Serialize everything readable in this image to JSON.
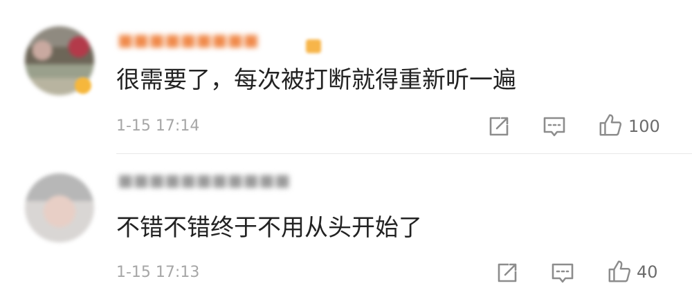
{
  "comments": [
    {
      "username": "■■■■■■■■■",
      "text": "很需要了，每次被打断就得重新听一遍",
      "time": "1-15 17:14",
      "likes": "100"
    },
    {
      "username": "■■■■■■■■■■■",
      "text": "不错不错终于不用从头开始了",
      "time": "1-15 17:13",
      "likes": "40"
    }
  ],
  "icons": {
    "share": "share-icon",
    "reply": "comment-icon",
    "like": "thumbs-up-icon"
  },
  "colors": {
    "text": "#222222",
    "meta": "#a6a6a6",
    "icon": "#8c8c8c",
    "username_highlight": "#f08a4b"
  }
}
